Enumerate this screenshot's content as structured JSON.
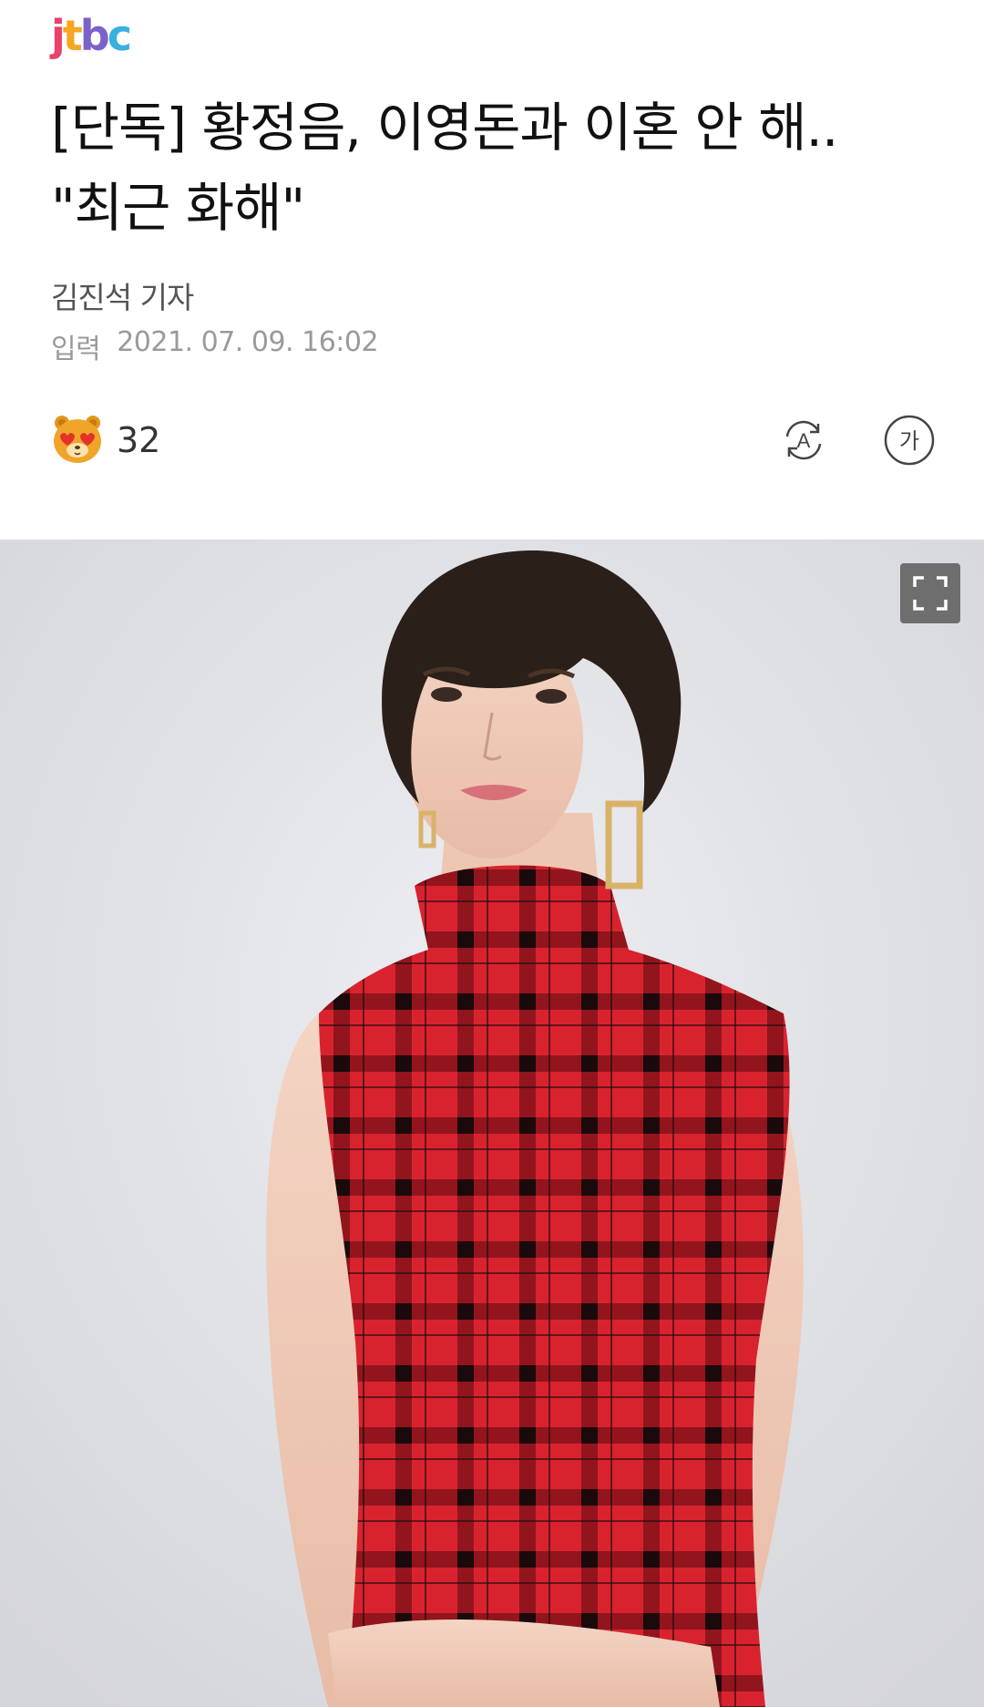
{
  "brand": {
    "logo_letters": [
      "j",
      "t",
      "b",
      "c"
    ],
    "logo_colors": [
      "#e8416a",
      "#f5a623",
      "#7b61c9",
      "#3ab0e0"
    ]
  },
  "article": {
    "headline_line1": "[단독] 황정음, 이영돈과 이혼 안 해..",
    "headline_line2": "\"최근 화해\"",
    "reporter": "김진석 기자",
    "published_label": "입력",
    "published_date": "2021. 07. 09. 16:02"
  },
  "actions": {
    "reaction_count": "32",
    "reaction_icon": "bear-heart-eyes-icon",
    "translate_icon": "translate-icon",
    "translate_glyph": "A",
    "font_size_icon": "font-size-icon",
    "font_size_glyph": "가"
  },
  "photo": {
    "expand_icon": "fullscreen-icon",
    "background_color": "#dfe0e4",
    "dress_color": "#d8232f"
  }
}
